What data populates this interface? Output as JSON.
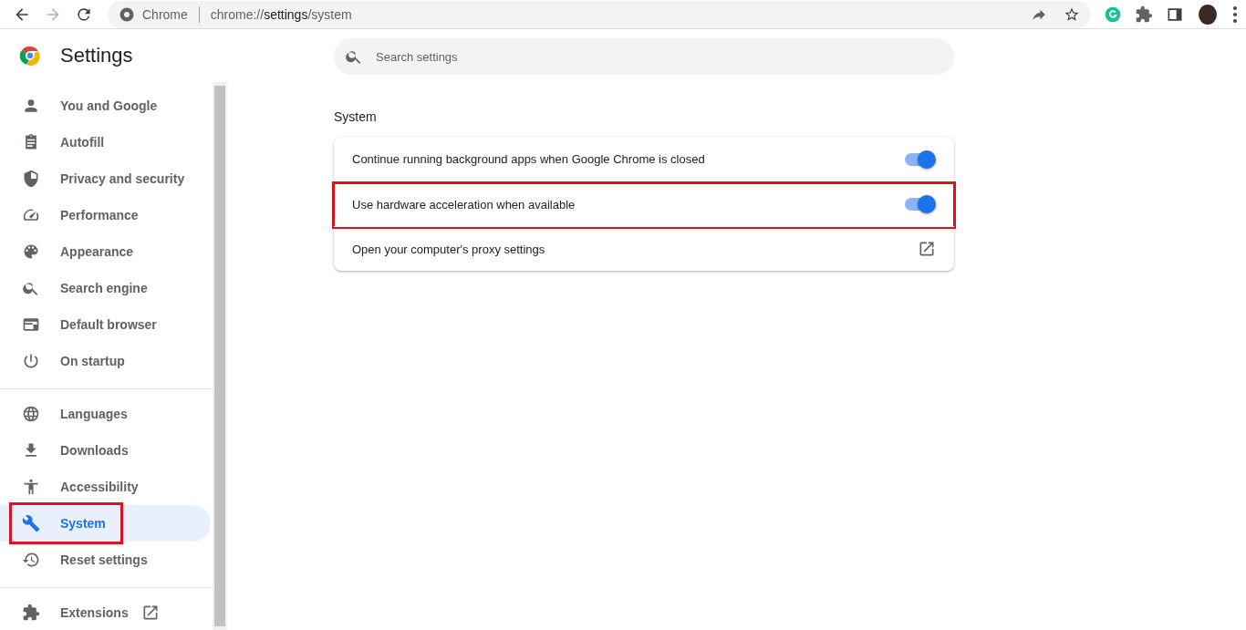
{
  "browser": {
    "site_label": "Chrome",
    "url_prefix": "chrome://",
    "url_host": "settings",
    "url_path": "/system"
  },
  "header": {
    "title": "Settings"
  },
  "search": {
    "placeholder": "Search settings"
  },
  "sidebar": {
    "groups": [
      {
        "items": [
          {
            "label": "You and Google",
            "selected": false
          },
          {
            "label": "Autofill",
            "selected": false
          },
          {
            "label": "Privacy and security",
            "selected": false
          },
          {
            "label": "Performance",
            "selected": false
          },
          {
            "label": "Appearance",
            "selected": false
          },
          {
            "label": "Search engine",
            "selected": false
          },
          {
            "label": "Default browser",
            "selected": false
          },
          {
            "label": "On startup",
            "selected": false
          }
        ]
      },
      {
        "items": [
          {
            "label": "Languages",
            "selected": false
          },
          {
            "label": "Downloads",
            "selected": false
          },
          {
            "label": "Accessibility",
            "selected": false
          },
          {
            "label": "System",
            "selected": true,
            "highlighted": true
          },
          {
            "label": "Reset settings",
            "selected": false
          }
        ]
      }
    ],
    "extensions": {
      "label": "Extensions"
    }
  },
  "section": {
    "title": "System",
    "rows": [
      {
        "kind": "toggle",
        "label": "Continue running background apps when Google Chrome is closed",
        "on": true
      },
      {
        "kind": "toggle",
        "label": "Use hardware acceleration when available",
        "on": true,
        "highlighted": true
      },
      {
        "kind": "link",
        "label": "Open your computer's proxy settings"
      }
    ]
  }
}
